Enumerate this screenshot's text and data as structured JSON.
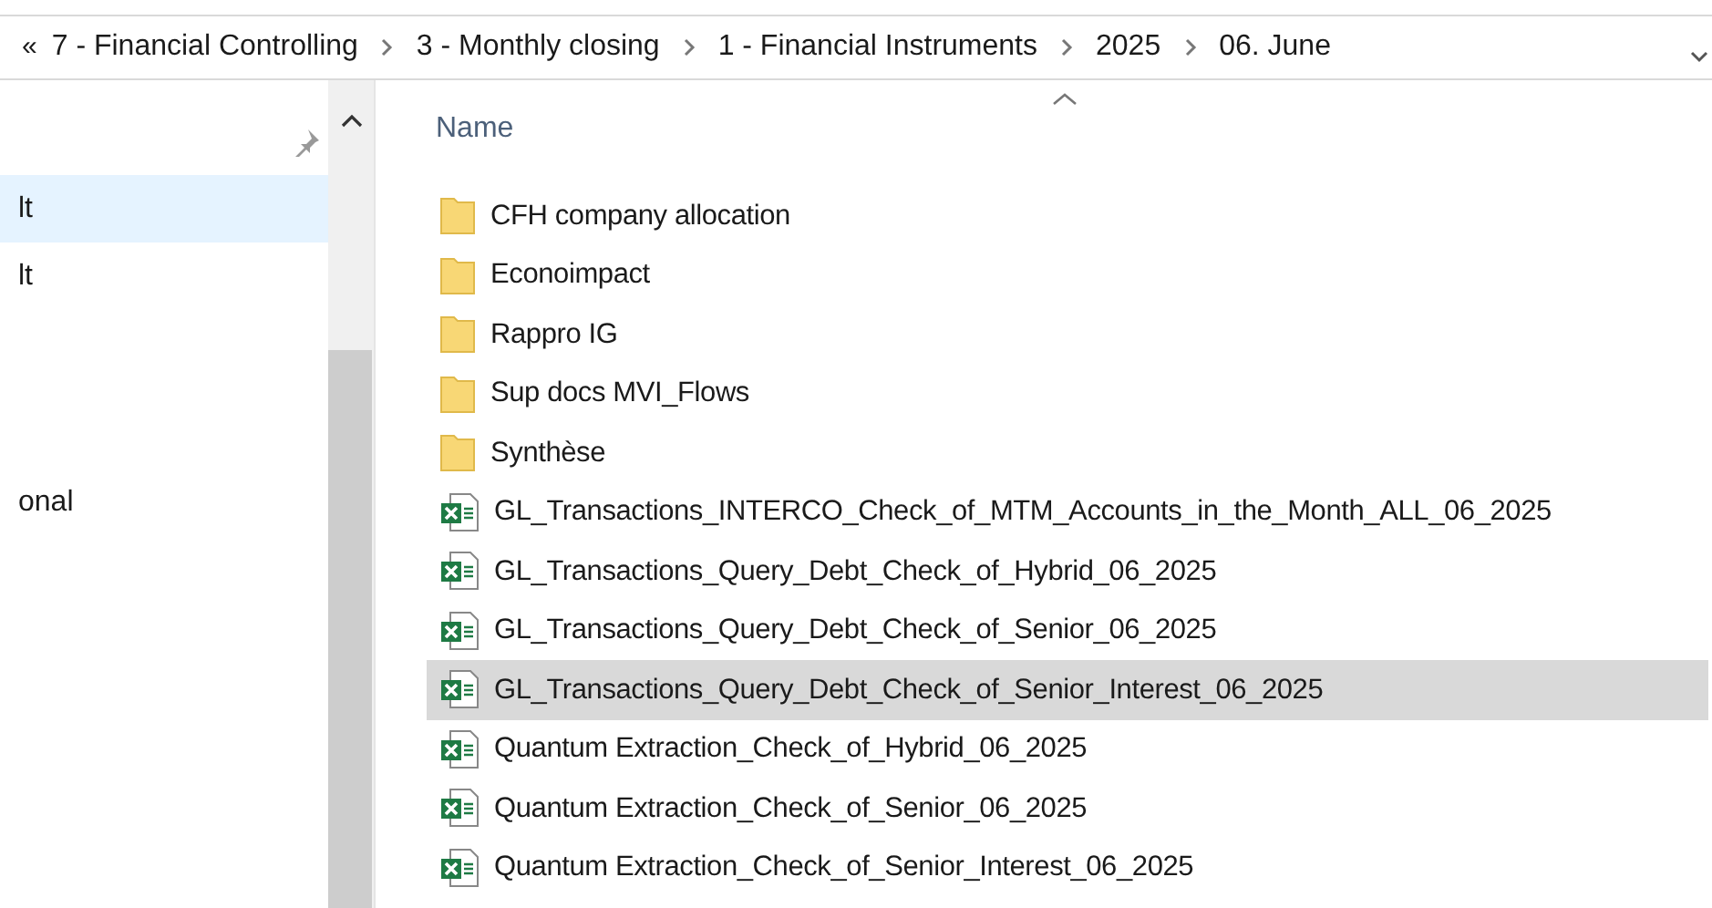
{
  "breadcrumb": {
    "overflow": "«",
    "segments": [
      "7 - Financial Controlling",
      "3 - Monthly closing",
      "1 - Financial Instruments",
      "2025",
      "06. June"
    ]
  },
  "sidebar": {
    "items": [
      {
        "label": "lt",
        "selected": true
      },
      {
        "label": "lt",
        "selected": false
      },
      {
        "label": "onal",
        "selected": false
      }
    ]
  },
  "file_list": {
    "columns": [
      "Name"
    ],
    "rows": [
      {
        "name": "CFH company allocation",
        "kind": "folder",
        "selected": false
      },
      {
        "name": "Econoimpact",
        "kind": "folder",
        "selected": false
      },
      {
        "name": "Rappro IG",
        "kind": "folder",
        "selected": false
      },
      {
        "name": "Sup docs MVI_Flows",
        "kind": "folder",
        "selected": false
      },
      {
        "name": "Synthèse",
        "kind": "folder",
        "selected": false
      },
      {
        "name": "GL_Transactions_INTERCO_Check_of_MTM_Accounts_in_the_Month_ALL_06_2025",
        "kind": "excel",
        "selected": false
      },
      {
        "name": "GL_Transactions_Query_Debt_Check_of_Hybrid_06_2025",
        "kind": "excel",
        "selected": false
      },
      {
        "name": "GL_Transactions_Query_Debt_Check_of_Senior_06_2025",
        "kind": "excel",
        "selected": false
      },
      {
        "name": "GL_Transactions_Query_Debt_Check_of_Senior_Interest_06_2025",
        "kind": "excel",
        "selected": true
      },
      {
        "name": "Quantum Extraction_Check_of_Hybrid_06_2025",
        "kind": "excel",
        "selected": false
      },
      {
        "name": "Quantum Extraction_Check_of_Senior_06_2025",
        "kind": "excel",
        "selected": false
      },
      {
        "name": "Quantum Extraction_Check_of_Senior_Interest_06_2025",
        "kind": "excel",
        "selected": false
      }
    ]
  }
}
